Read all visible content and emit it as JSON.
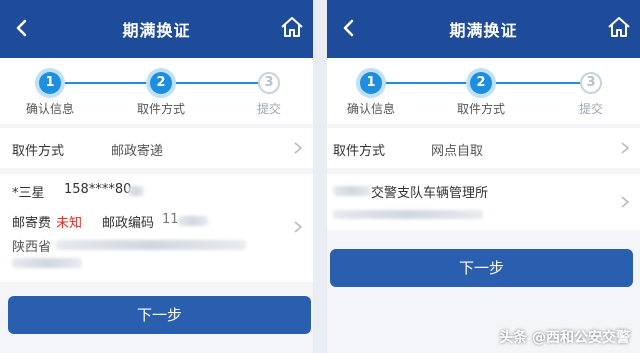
{
  "left": {
    "title": "期满换证",
    "steps": [
      {
        "num": "1",
        "label": "确认信息"
      },
      {
        "num": "2",
        "label": "取件方式"
      },
      {
        "num": "3",
        "label": "提交"
      }
    ],
    "pickup_label": "取件方式",
    "pickup_value": "邮政寄递",
    "recipient_name": "*三星",
    "recipient_phone": "158****80",
    "postage_label": "邮寄费",
    "postage_value": "未知",
    "postcode_label": "邮政编码",
    "postcode_value": "11",
    "address_prefix": "陕西省",
    "next_label": "下一步"
  },
  "right": {
    "title": "期满换证",
    "steps": [
      {
        "num": "1",
        "label": "确认信息"
      },
      {
        "num": "2",
        "label": "取件方式"
      },
      {
        "num": "3",
        "label": "提交"
      }
    ],
    "pickup_label": "取件方式",
    "pickup_value": "网点自取",
    "office_name": "交警支队车辆管理所",
    "next_label": "下一步"
  },
  "watermark": "头条 @西和公安交警",
  "colors": {
    "header": "#1e4c9a",
    "step_active": "#1d8ee0",
    "button": "#2a5fb0",
    "postage_unknown": "#e0302a"
  },
  "icons": [
    "back-arrow-icon",
    "home-icon",
    "chevron-right-icon"
  ]
}
